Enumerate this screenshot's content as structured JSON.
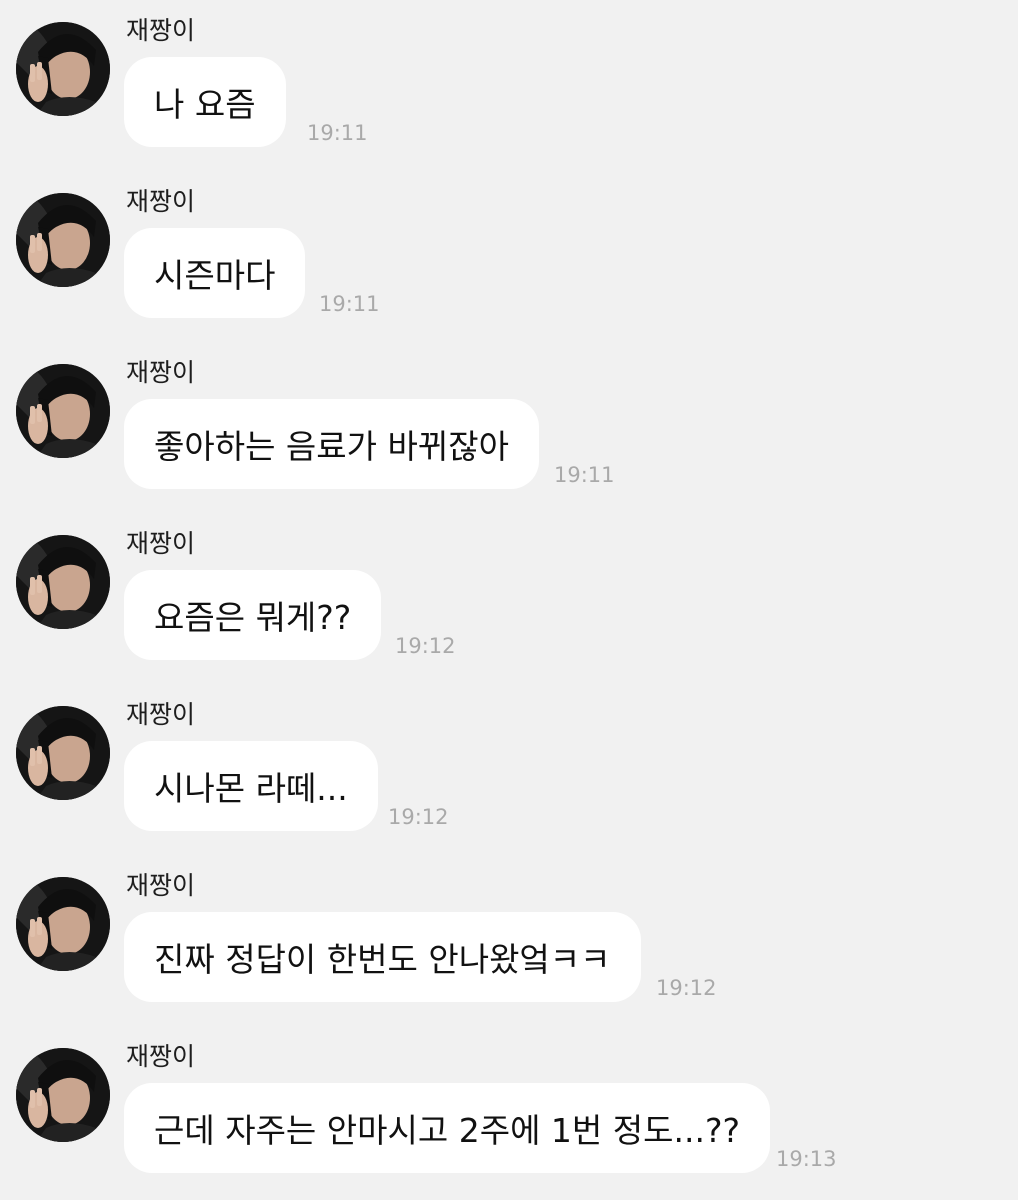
{
  "chat": {
    "messages": [
      {
        "sender": "재짱이",
        "text": "나 요즘",
        "time": "19:11"
      },
      {
        "sender": "재짱이",
        "text": "시즌마다",
        "time": "19:11"
      },
      {
        "sender": "재짱이",
        "text": "좋아하는 음료가 바뀌잖아",
        "time": "19:11"
      },
      {
        "sender": "재짱이",
        "text": "요즘은 뭐게??",
        "time": "19:12"
      },
      {
        "sender": "재짱이",
        "text": "시나몬 라떼...",
        "time": "19:12"
      },
      {
        "sender": "재짱이",
        "text": "진짜 정답이 한번도 안나왔엌ㅋㅋ",
        "time": "19:12"
      },
      {
        "sender": "재짱이",
        "text": "근데 자주는 안마시고 2주에 1번 정도...??",
        "time": "19:13"
      }
    ]
  },
  "colors": {
    "background": "#f1f1f1",
    "bubble": "#ffffff",
    "text": "#111111",
    "timestamp": "#a9a9a9"
  },
  "icons": {
    "avatar": "profile-photo-avatar"
  }
}
